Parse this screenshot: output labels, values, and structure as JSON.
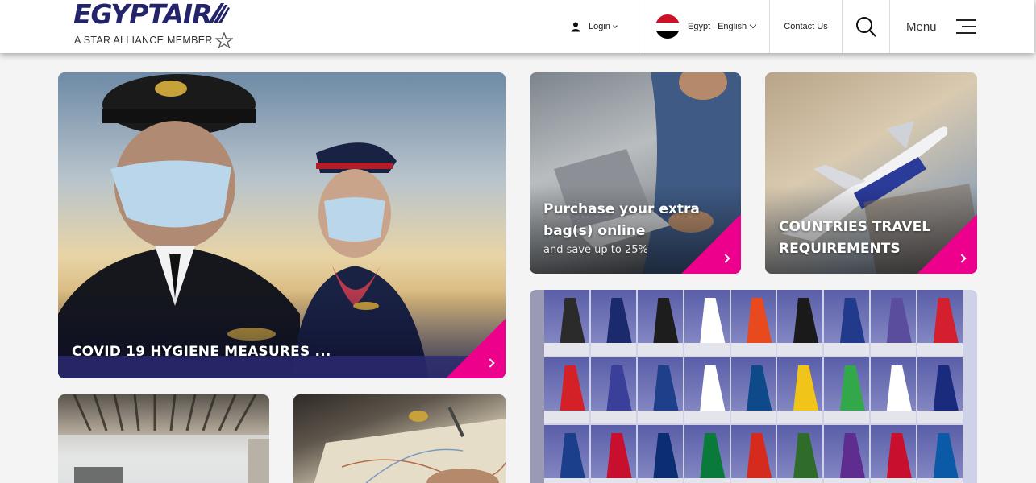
{
  "header": {
    "logo_text": "EGYPTAIR",
    "logo_tagline": "A STAR ALLIANCE MEMBER",
    "login_label": "Login",
    "language_label": "Egypt | English",
    "contact_label": "Contact Us",
    "menu_label": "Menu"
  },
  "tiles": {
    "covid": {
      "title": "COVID 19 HYGIENE MEASURES ..."
    },
    "bags": {
      "title": "Purchase your extra bag(s) online",
      "subtitle": "and save up to 25%"
    },
    "countries": {
      "title": "COUNTRIES TRAVEL REQUIREMENTS"
    },
    "alliance": {
      "image": "star-alliance-airline-tails"
    },
    "lounge": {
      "image": "airport-lounge"
    },
    "map": {
      "image": "travel-map"
    }
  },
  "colors": {
    "accent": "#ec008c",
    "brand_navy": "#24246a"
  },
  "tail_colors": [
    "#2b2b2b",
    "#1a2a6c",
    "#1d1d1d",
    "#ffffff",
    "#e8491d",
    "#1a1a1a",
    "#223a8c",
    "#5b4d9e",
    "#d41f2e",
    "#d42027",
    "#3a3f9a",
    "#1e3f8a",
    "#ffffff",
    "#0e4a8a",
    "#f0c419",
    "#33a84a",
    "#ffffff",
    "#1a2a7c",
    "#1c3f8c",
    "#c8102e",
    "#0b2d72",
    "#0a7a3a",
    "#d52b1e",
    "#2f6c2a",
    "#5e2d8f",
    "#c8102e",
    "#0a5aa8"
  ]
}
